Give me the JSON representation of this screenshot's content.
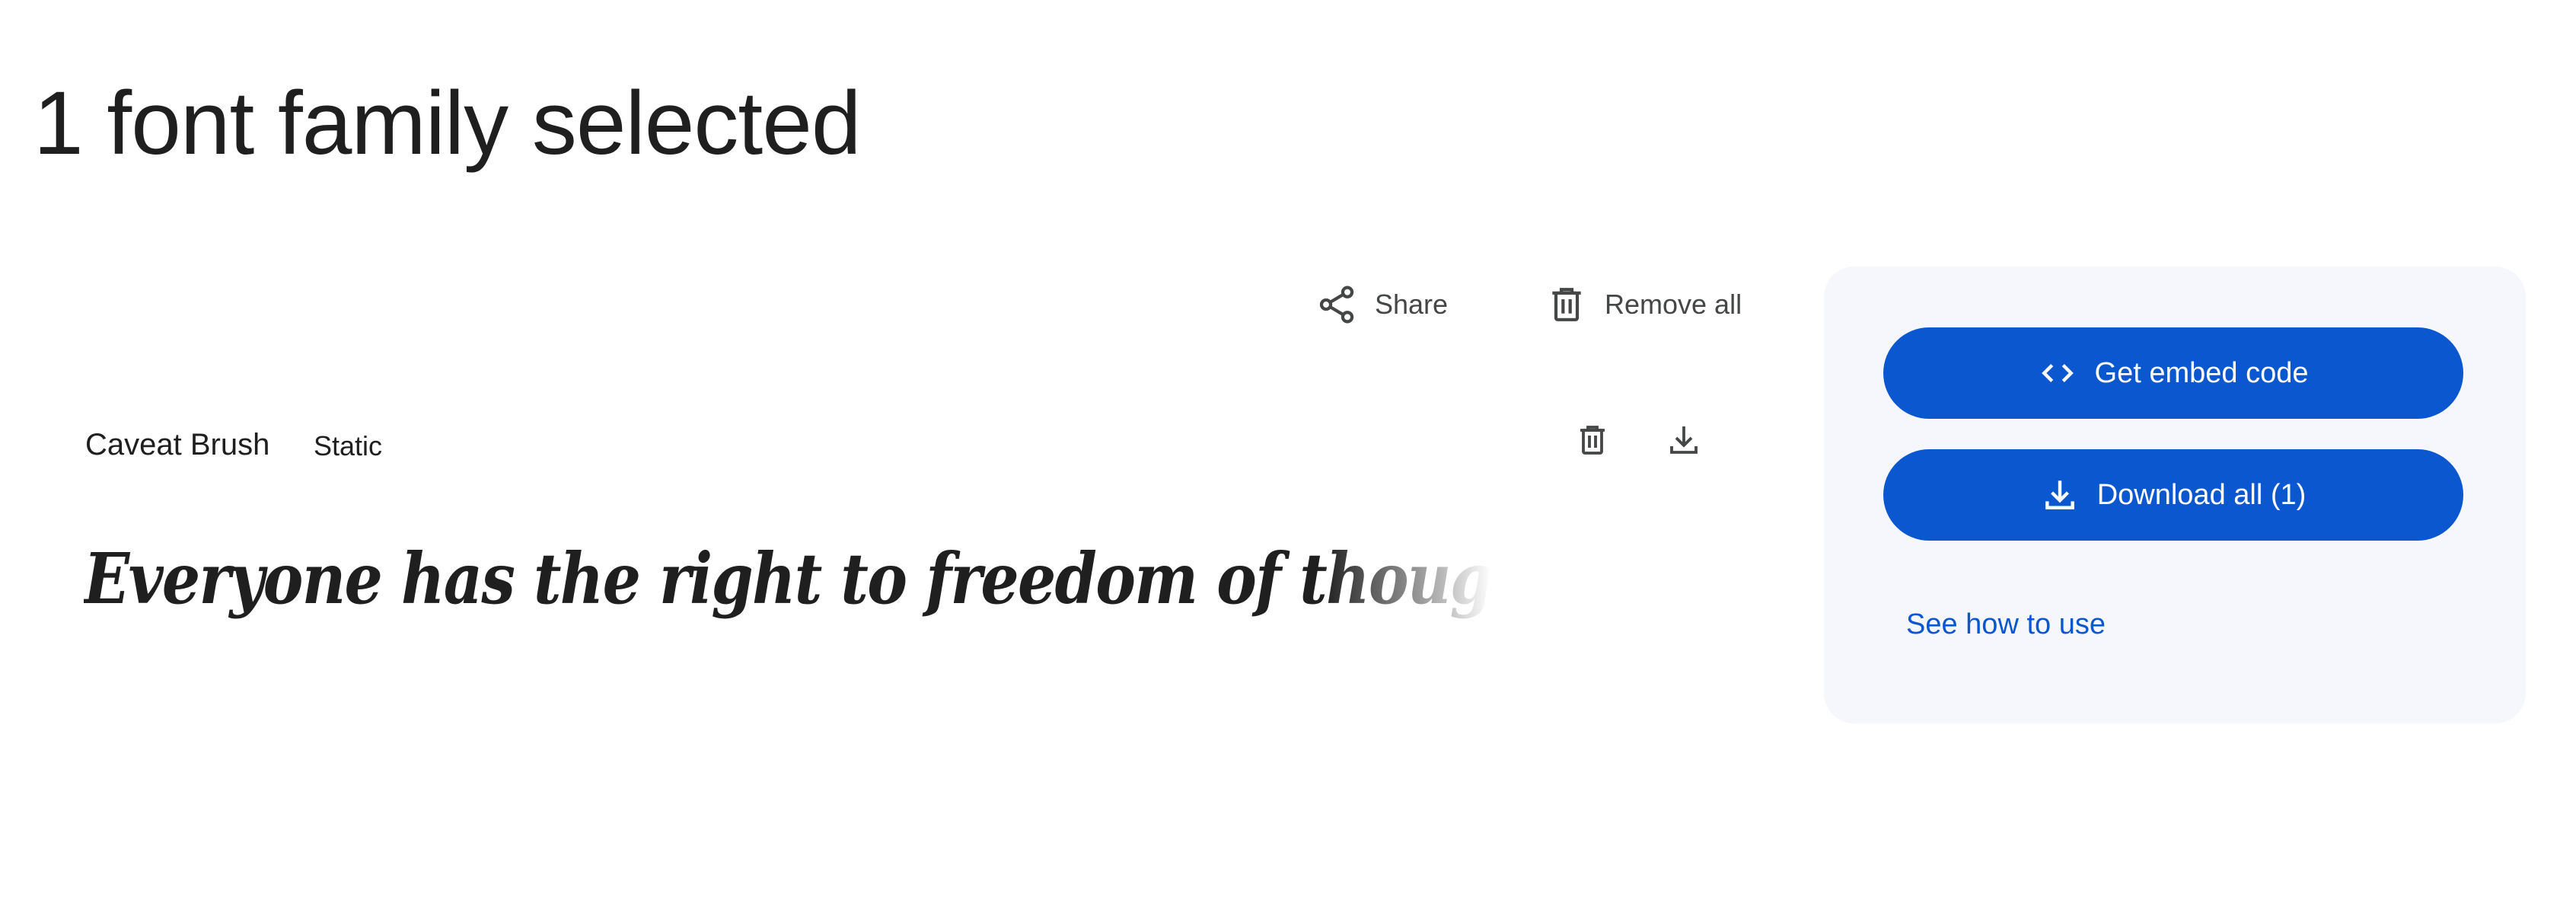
{
  "page": {
    "title": "1 font family selected"
  },
  "toolbar": {
    "share_label": "Share",
    "remove_all_label": "Remove all",
    "share_icon": "share-icon",
    "remove_all_icon": "trash-icon"
  },
  "font_row": {
    "family": "Caveat Brush",
    "type": "Static",
    "remove_icon": "trash-icon",
    "download_icon": "download-icon",
    "preview_text": "Everyone has the right to freedom of thought, conscience and"
  },
  "side_panel": {
    "embed_label": "Get embed code",
    "embed_icon": "code-brackets-icon",
    "download_all_label": "Download all (1)",
    "download_all_icon": "download-icon",
    "how_to_label": "See how to use"
  },
  "colors": {
    "accent": "#0b57d0",
    "panel_background": "#f5f7fc",
    "text": "#1f1f1f",
    "icon": "#444746"
  }
}
